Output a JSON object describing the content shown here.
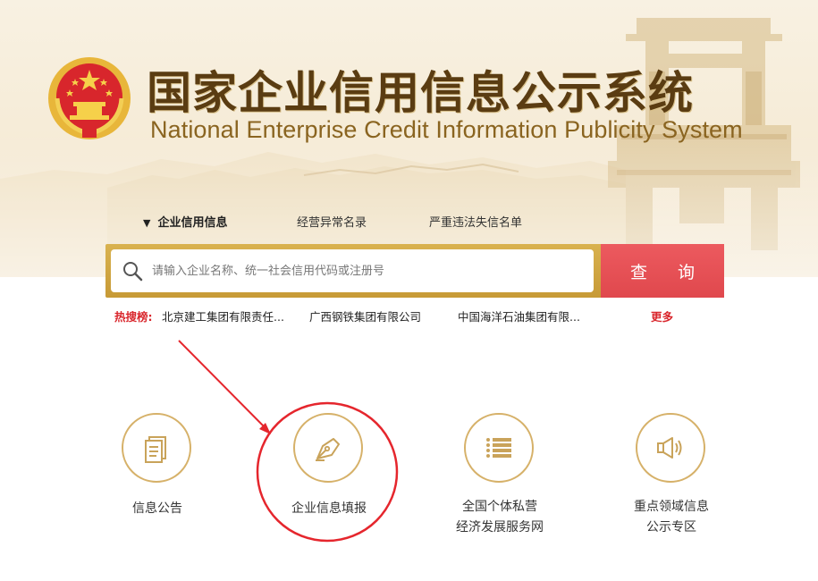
{
  "header": {
    "title_cn": "国家企业信用信息公示系统",
    "title_en": "National Enterprise Credit Information Publicity System",
    "emblem_icon": "national-emblem-icon"
  },
  "tabs": [
    {
      "label": "企业信用信息",
      "active": true
    },
    {
      "label": "经营异常名录",
      "active": false
    },
    {
      "label": "严重违法失信名单",
      "active": false
    }
  ],
  "search": {
    "placeholder": "请输入企业名称、统一社会信用代码或注册号",
    "value": "",
    "button_label": "查 询",
    "icon": "search-icon"
  },
  "hot_search": {
    "label": "热搜榜:",
    "items": [
      "北京建工集团有限责任...",
      "广西钢铁集团有限公司",
      "中国海洋石油集团有限..."
    ],
    "more_label": "更多"
  },
  "services": [
    {
      "line1": "信息公告",
      "line2": "",
      "icon": "document-icon"
    },
    {
      "line1": "企业信息填报",
      "line2": "",
      "icon": "pen-nib-icon"
    },
    {
      "line1": "全国个体私营",
      "line2": "经济发展服务网",
      "icon": "list-icon"
    },
    {
      "line1": "重点领域信息",
      "line2": "公示专区",
      "icon": "speaker-icon"
    }
  ],
  "colors": {
    "title": "#5a3c12",
    "gold_border": "#c79a36",
    "search_button": "#e0484d",
    "hot_label": "#d9262c",
    "icon_gold": "#c9a35a",
    "annotation_red": "#e5262d"
  }
}
